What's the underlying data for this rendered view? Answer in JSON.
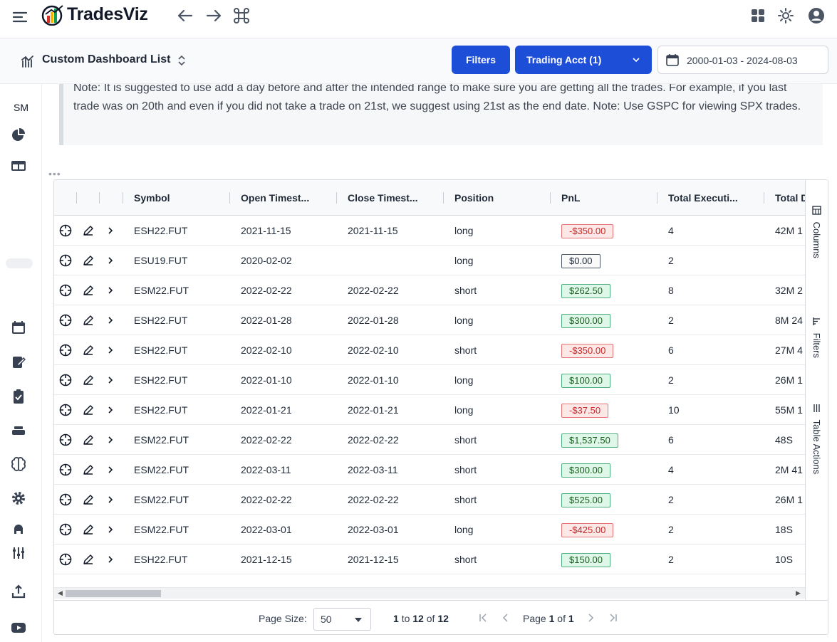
{
  "app": {
    "brand": "TradesViz"
  },
  "topbar": {
    "icons": [
      "menu-icon",
      "back-arrow-icon",
      "forward-arrow-icon",
      "command-icon",
      "apps-grid-icon",
      "theme-sun-icon",
      "account-icon"
    ]
  },
  "subbar": {
    "dashboard_title": "Custom Dashboard List",
    "filters_label": "Filters",
    "account_label": "Trading Acct (1)",
    "date_range": "2000-01-03 - 2024-08-03"
  },
  "sidebar": {
    "badge": "SM"
  },
  "note": {
    "text": "Note: It is suggested to use add a day before and after the intended range to make sure you are getting all the trades. For example, if you last trade was on 20th and even if you did not take a trade on 21st, we suggest using 21st as the end date. Note: Use GSPC for viewing SPX trades."
  },
  "table": {
    "columns": [
      "Symbol",
      "Open Timest...",
      "Close Timest...",
      "Position",
      "PnL",
      "Total Executi...",
      "Total D"
    ],
    "rows": [
      {
        "symbol": "ESH22.FUT",
        "open": "2021-11-15",
        "close": "2021-11-15",
        "position": "long",
        "pnl": "-$350.00",
        "pnl_sign": "neg",
        "executions": "4",
        "duration": "42M 1"
      },
      {
        "symbol": "ESU19.FUT",
        "open": "2020-02-02",
        "close": "",
        "position": "long",
        "pnl": "$0.00",
        "pnl_sign": "zero",
        "executions": "2",
        "duration": ""
      },
      {
        "symbol": "ESM22.FUT",
        "open": "2022-02-22",
        "close": "2022-02-22",
        "position": "short",
        "pnl": "$262.50",
        "pnl_sign": "pos",
        "executions": "8",
        "duration": "32M 2"
      },
      {
        "symbol": "ESH22.FUT",
        "open": "2022-01-28",
        "close": "2022-01-28",
        "position": "long",
        "pnl": "$300.00",
        "pnl_sign": "pos",
        "executions": "2",
        "duration": "8M 24"
      },
      {
        "symbol": "ESH22.FUT",
        "open": "2022-02-10",
        "close": "2022-02-10",
        "position": "short",
        "pnl": "-$350.00",
        "pnl_sign": "neg",
        "executions": "6",
        "duration": "27M 4"
      },
      {
        "symbol": "ESH22.FUT",
        "open": "2022-01-10",
        "close": "2022-01-10",
        "position": "long",
        "pnl": "$100.00",
        "pnl_sign": "pos",
        "executions": "2",
        "duration": "26M 1"
      },
      {
        "symbol": "ESH22.FUT",
        "open": "2022-01-21",
        "close": "2022-01-21",
        "position": "long",
        "pnl": "-$37.50",
        "pnl_sign": "neg",
        "executions": "10",
        "duration": "55M 1"
      },
      {
        "symbol": "ESM22.FUT",
        "open": "2022-02-22",
        "close": "2022-02-22",
        "position": "short",
        "pnl": "$1,537.50",
        "pnl_sign": "pos",
        "executions": "6",
        "duration": "48S"
      },
      {
        "symbol": "ESM22.FUT",
        "open": "2022-03-11",
        "close": "2022-03-11",
        "position": "short",
        "pnl": "$300.00",
        "pnl_sign": "pos",
        "executions": "4",
        "duration": "2M 41"
      },
      {
        "symbol": "ESM22.FUT",
        "open": "2022-02-22",
        "close": "2022-02-22",
        "position": "short",
        "pnl": "$525.00",
        "pnl_sign": "pos",
        "executions": "2",
        "duration": "26M 1"
      },
      {
        "symbol": "ESM22.FUT",
        "open": "2022-03-01",
        "close": "2022-03-01",
        "position": "long",
        "pnl": "-$425.00",
        "pnl_sign": "neg",
        "executions": "2",
        "duration": "18S"
      },
      {
        "symbol": "ESH22.FUT",
        "open": "2021-12-15",
        "close": "2021-12-15",
        "position": "short",
        "pnl": "$150.00",
        "pnl_sign": "pos",
        "executions": "2",
        "duration": "10S"
      }
    ],
    "side_tabs": [
      "Columns",
      "Filters",
      "Table Actions"
    ]
  },
  "pagination": {
    "page_size_label": "Page Size:",
    "page_size": "50",
    "from": "1",
    "to_word": "to",
    "to": "12",
    "of_word": "of",
    "total": "12",
    "page_word": "Page",
    "current_page": "1",
    "page_of_word": "of",
    "total_pages": "1"
  },
  "colors": {
    "primary": "#1d4ed8",
    "negative": "#c62828",
    "positive": "#1b5e20"
  }
}
